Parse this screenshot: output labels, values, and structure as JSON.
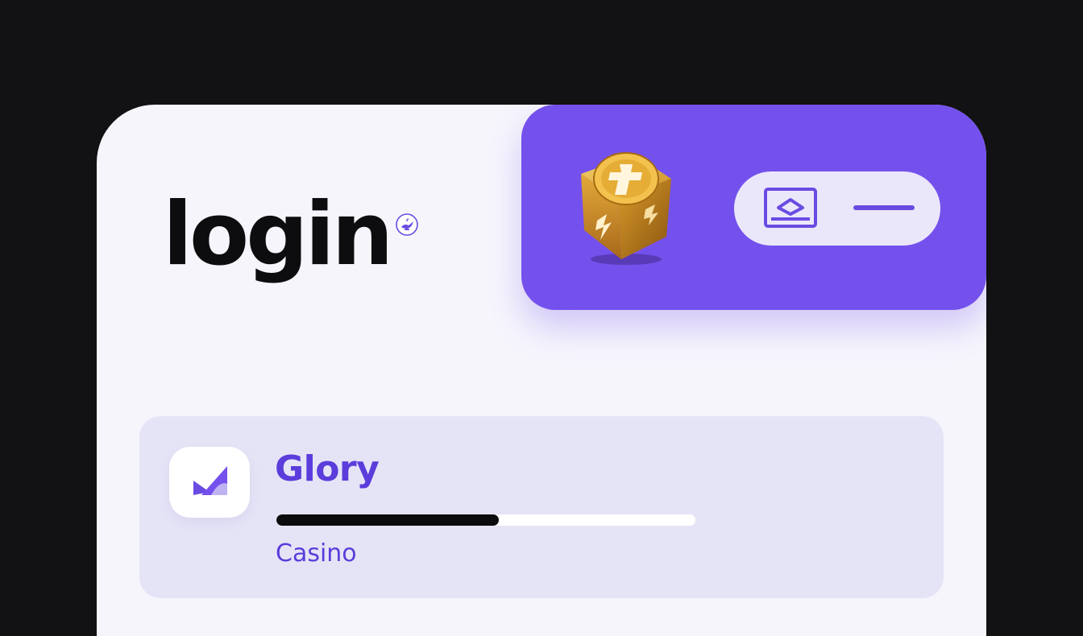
{
  "header": {
    "title": "login",
    "title_badge_icon": "genie-lamp-icon"
  },
  "top_panel": {
    "color": "#7451ec",
    "dice_icon": "golden-dice-icon",
    "toggle": {
      "icon": "card-toggle-icon",
      "state": "collapsed"
    }
  },
  "game": {
    "logo_icon": "glory-logo-icon",
    "name": "Glory",
    "subtitle": "Casino",
    "progress": 0.53,
    "accent_color": "#5b3ddb"
  }
}
